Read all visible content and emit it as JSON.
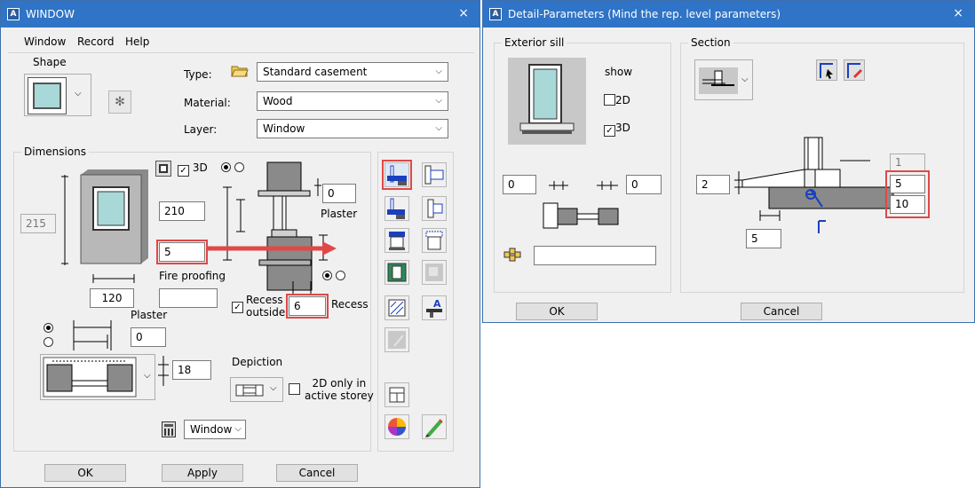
{
  "win1": {
    "title": "WINDOW",
    "close": "×",
    "menu": [
      "Window",
      "Record",
      "Help"
    ],
    "shape_label": "Shape",
    "type_label": "Type:",
    "type_value": "Standard casement",
    "material_label": "Material:",
    "material_value": "Wood",
    "layer_label": "Layer:",
    "layer_value": "Window",
    "dimensions_label": "Dimensions",
    "check_3d": "3D",
    "height_grey": "215",
    "height": "210",
    "sill": "5",
    "width": "120",
    "fire_proofing_label": "Fire proofing",
    "fire_proofing_value": "",
    "plaster_top_value": "0",
    "plaster_top_label": "Plaster",
    "recess_outside_line1": "Recess",
    "recess_outside_line2": "outside",
    "recess_value": "6",
    "recess_label": "Recess",
    "plaster_left_label": "Plaster",
    "plaster_left_value": "0",
    "reveal_value": "18",
    "depiction_label": "Depiction",
    "only2d_line1": "2D only in",
    "only2d_line2": "active storey",
    "layer_select": "Window",
    "ok": "OK",
    "apply": "Apply",
    "cancel": "Cancel"
  },
  "win2": {
    "title": "Detail-Parameters (Mind the rep. level parameters)",
    "close": "×",
    "exterior_sill_label": "Exterior sill",
    "show_label": "show",
    "check_2d": "2D",
    "check_3d": "3D",
    "left_value": "0",
    "right_value": "0",
    "text_value": "",
    "section_label": "Section",
    "sec_left_value": "2",
    "sec_grey_value": "1",
    "sec_val_a": "5",
    "sec_val_b": "10",
    "sec_bottom_value": "5",
    "ok": "OK",
    "cancel": "Cancel"
  },
  "colors": {
    "titlebar": "#2f74c6",
    "highlight": "#e04848",
    "glass": "#a8d8d8"
  }
}
